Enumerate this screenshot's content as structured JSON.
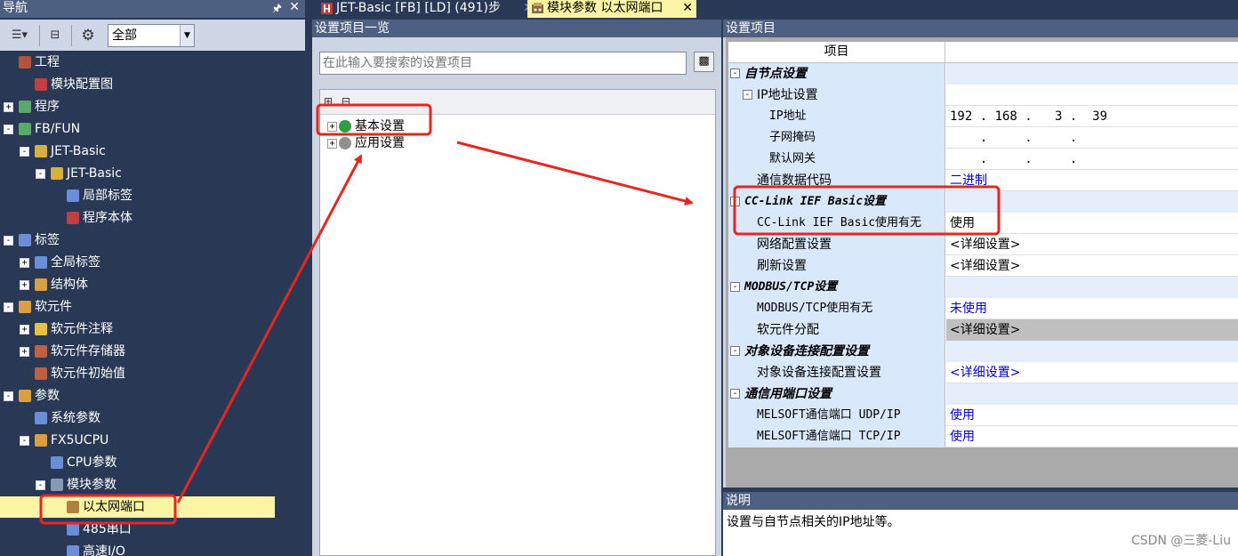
{
  "nav": {
    "title": "导航",
    "pin_icon": "pin-icon",
    "close_icon": "close-icon",
    "filter_value": "全部",
    "tree": [
      {
        "label": "工程",
        "indent": 0,
        "expander": "",
        "icon_color": "#b0543a"
      },
      {
        "label": "模块配置图",
        "indent": 1,
        "expander": "",
        "icon_color": "#c04040"
      },
      {
        "label": "程序",
        "indent": 0,
        "expander": "+",
        "icon_color": "#5aa86b"
      },
      {
        "label": "FB/FUN",
        "indent": 0,
        "expander": "-",
        "icon_color": "#5aa86b"
      },
      {
        "label": "JET-Basic",
        "indent": 1,
        "expander": "-",
        "icon_color": "#d8b040"
      },
      {
        "label": "JET-Basic",
        "indent": 2,
        "expander": "-",
        "icon_color": "#d8b040"
      },
      {
        "label": "局部标签",
        "indent": 3,
        "expander": "",
        "icon_color": "#6a8fd8"
      },
      {
        "label": "程序本体",
        "indent": 3,
        "expander": "",
        "icon_color": "#c04040"
      },
      {
        "label": "标签",
        "indent": 0,
        "expander": "-",
        "icon_color": "#6a8fd8"
      },
      {
        "label": "全局标签",
        "indent": 1,
        "expander": "+",
        "icon_color": "#6a8fd8"
      },
      {
        "label": "结构体",
        "indent": 1,
        "expander": "+",
        "icon_color": "#d8a040"
      },
      {
        "label": "软元件",
        "indent": 0,
        "expander": "-",
        "icon_color": "#d8a040"
      },
      {
        "label": "软元件注释",
        "indent": 1,
        "expander": "+",
        "icon_color": "#e8c040"
      },
      {
        "label": "软元件存储器",
        "indent": 1,
        "expander": "+",
        "icon_color": "#c06040"
      },
      {
        "label": "软元件初始值",
        "indent": 1,
        "expander": "",
        "icon_color": "#c06040"
      },
      {
        "label": "参数",
        "indent": 0,
        "expander": "-",
        "icon_color": "#d8a040"
      },
      {
        "label": "系统参数",
        "indent": 1,
        "expander": "",
        "icon_color": "#6a8fd8"
      },
      {
        "label": "FX5UCPU",
        "indent": 1,
        "expander": "-",
        "icon_color": "#d8a040"
      },
      {
        "label": "CPU参数",
        "indent": 2,
        "expander": "",
        "icon_color": "#6a8fd8"
      },
      {
        "label": "模块参数",
        "indent": 2,
        "expander": "-",
        "icon_color": "#8898b5"
      },
      {
        "label": "以太网端口",
        "indent": 3,
        "expander": "",
        "icon_color": "#b08040",
        "selected": true
      },
      {
        "label": "485串口",
        "indent": 3,
        "expander": "",
        "icon_color": "#6a8fd8"
      },
      {
        "label": "高速I/O",
        "indent": 3,
        "expander": "",
        "icon_color": "#6a8fd8"
      }
    ]
  },
  "tabs": [
    {
      "label": "JET-Basic [FB] [LD] (491)步",
      "icon": "ladder-icon",
      "active": false
    },
    {
      "label": "模块参数 以太网端口",
      "icon": "module-param-icon",
      "active": true
    }
  ],
  "list_pane": {
    "title": "设置项目一览",
    "search_placeholder": "在此输入要搜索的设置项目",
    "items": [
      {
        "label": "基本设置",
        "icon_color": "#2e9d47"
      },
      {
        "label": "应用设置",
        "icon_color": "#909090"
      }
    ]
  },
  "grid_pane": {
    "title": "设置项目",
    "header": "项目",
    "rows": [
      {
        "name": "自节点设置",
        "value": "",
        "level": 0,
        "section": true,
        "expander": "-"
      },
      {
        "name": "IP地址设置",
        "value": "",
        "level": 1,
        "section": false,
        "expander": "-"
      },
      {
        "name": "IP地址",
        "value": "192 . 168 .   3 .  39",
        "level": 2,
        "mono": true
      },
      {
        "name": "子网掩码",
        "value": "    .     .     .",
        "level": 2,
        "mono": true
      },
      {
        "name": "默认网关",
        "value": "    .     .     .",
        "level": 2,
        "mono": true
      },
      {
        "name": "通信数据代码",
        "value": "二进制",
        "level": 1,
        "link": true
      },
      {
        "name": "CC-Link IEF Basic设置",
        "value": "",
        "level": 0,
        "section": true,
        "expander": "-",
        "mono": true
      },
      {
        "name": "CC-Link IEF Basic使用有无",
        "value": "使用",
        "level": 1,
        "mono": true
      },
      {
        "name": "网络配置设置",
        "value": "<详细设置>",
        "level": 1
      },
      {
        "name": "刷新设置",
        "value": "<详细设置>",
        "level": 1
      },
      {
        "name": "MODBUS/TCP设置",
        "value": "",
        "level": 0,
        "section": true,
        "expander": "-",
        "mono": true
      },
      {
        "name": "MODBUS/TCP使用有无",
        "value": "未使用",
        "level": 1,
        "link": true,
        "mono": true
      },
      {
        "name": "软元件分配",
        "value": "<详细设置>",
        "level": 1,
        "gray": true
      },
      {
        "name": "对象设备连接配置设置",
        "value": "",
        "level": 0,
        "section": true,
        "expander": "-"
      },
      {
        "name": "对象设备连接配置设置",
        "value": "<详细设置>",
        "level": 1,
        "link": true
      },
      {
        "name": "通信用端口设置",
        "value": "",
        "level": 0,
        "section": true,
        "expander": "-"
      },
      {
        "name": "MELSOFT通信端口 UDP/IP",
        "value": "使用",
        "level": 1,
        "link": true,
        "mono": true
      },
      {
        "name": "MELSOFT通信端口 TCP/IP",
        "value": "使用",
        "level": 1,
        "link": true,
        "mono": true
      }
    ]
  },
  "desc_pane": {
    "title": "说明",
    "text": "设置与自节点相关的IP地址等。"
  },
  "watermark": "CSDN @三菱-Liu",
  "colors": {
    "annotation_red": "#e8261f",
    "selected_bg": "#fdf4a5",
    "panel_title_bg": "#4d6082",
    "nav_bg": "#293955"
  }
}
